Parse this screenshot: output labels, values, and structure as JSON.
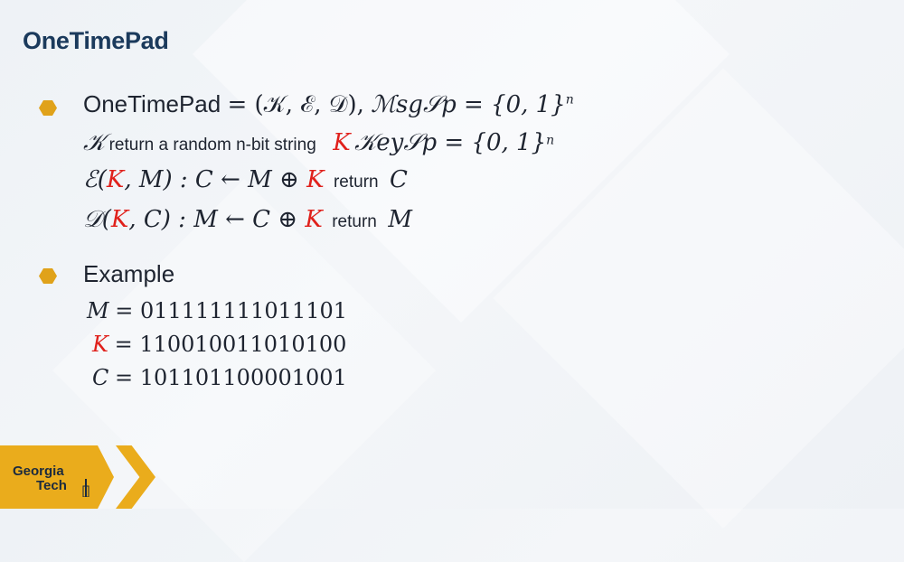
{
  "slide": {
    "title": "OneTimePad",
    "bullet1": {
      "label": "OneTimePad",
      "def": "= (𝒦, ℰ, 𝒟),",
      "msg_space": "ℳsg𝒮p = {0, 1}",
      "exp": "n"
    },
    "keygen": {
      "sym": "𝒦",
      "text": "return a random n-bit string",
      "k": "K",
      "key_space": "𝒦ey𝒮p = {0, 1}",
      "exp": "n"
    },
    "encrypt": {
      "lhs": "ℰ(",
      "k": "K",
      "mid": ", M) : C ← M ⊕ ",
      "k2": "K",
      "ret": "return",
      "out": "C"
    },
    "decrypt": {
      "lhs": "𝒟(",
      "k": "K",
      "mid": ", C) : M ← C ⊕ ",
      "k2": "K",
      "ret": "return",
      "out": "M"
    },
    "bullet2": {
      "label": "Example",
      "m_sym": "M",
      "m_val": "= 011111111011101",
      "k_sym": "K",
      "k_val": "= 110010011010100",
      "c_sym": "C",
      "c_val": "= 101101100001001"
    }
  },
  "logo": {
    "line1": "Georgia",
    "line2": "Tech"
  },
  "colors": {
    "accent": "#eaac1c",
    "title": "#1b3a5c",
    "key_red": "#e0201b"
  }
}
